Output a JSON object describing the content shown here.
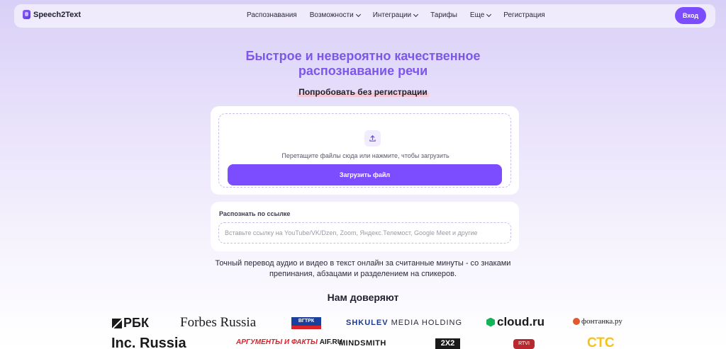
{
  "brand": {
    "name": "Speech2Text"
  },
  "nav": {
    "items": [
      {
        "label": "Распознавания",
        "dropdown": false
      },
      {
        "label": "Возможности",
        "dropdown": true
      },
      {
        "label": "Интеграции",
        "dropdown": true
      },
      {
        "label": "Тарифы",
        "dropdown": false
      },
      {
        "label": "Еще",
        "dropdown": true
      },
      {
        "label": "Регистрация",
        "dropdown": false
      }
    ],
    "login_label": "Вход"
  },
  "hero": {
    "title_line1": "Быстрое и невероятно качественное",
    "title_line2": "распознавание речи",
    "try_label": "Попробовать без регистрации"
  },
  "upload": {
    "drop_text": "Перетащите файлы сюда или нажмите, чтобы загрузить",
    "button_label": "Загрузить файл",
    "icon": "upload-icon"
  },
  "link": {
    "label": "Распознать по ссылке",
    "placeholder": "Вставьте ссылку на YouTube/VK/Dzen, Zoom, Яндекс.Телемост, Google Meet и другие",
    "value": ""
  },
  "description": {
    "line1": "Точный перевод аудио и видео в текст онлайн за считанные минуты - со знаками",
    "line2": "препинания, абзацами и разделением на спикеров."
  },
  "trust": {
    "title": "Нам доверяют",
    "logos": {
      "rbk": "РБК",
      "forbes": "Forbes Russia",
      "vgtrk": "ВГТРК",
      "shkulev_a": "SHKULEV",
      "shkulev_b": " MEDIA HOLDING",
      "cloud": "cloud.ru",
      "fontanka": "фонтанка.ру",
      "inc": "Inc. Russia",
      "aif_a": "АРГУМЕНТЫ И ФАКТЫ",
      "aif_b": "AIF.RU",
      "mindsmith": "MINDSMITH",
      "twox2": "2X2",
      "rtvi": "RTVI",
      "ctc": "СТС"
    }
  },
  "colors": {
    "accent": "#7c4dff",
    "title": "#7c57e8",
    "background_top": "#d9d0f7"
  }
}
